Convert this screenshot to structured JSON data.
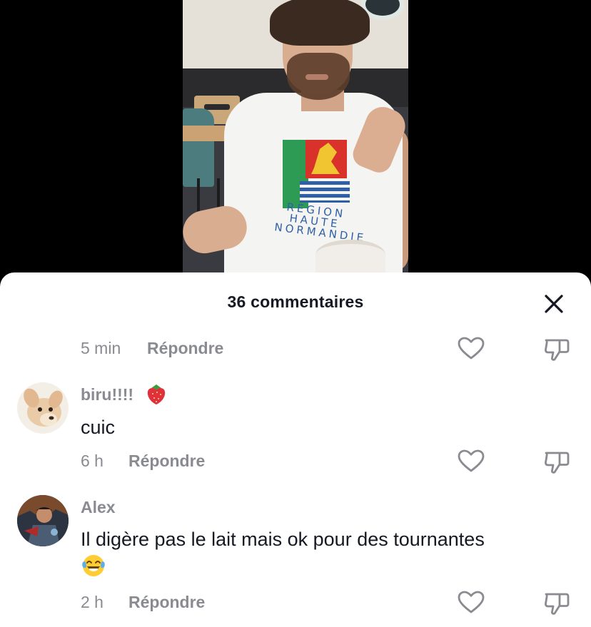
{
  "sheet": {
    "title": "36 commentaires",
    "close_icon": "close-icon"
  },
  "comments": [
    {
      "time": "5 min",
      "reply_label": "Répondre",
      "like_icon": "heart-outline-icon",
      "dislike_icon": "thumbs-down-icon"
    },
    {
      "username": "biru!!!!",
      "username_emoji": "strawberry",
      "avatar": "chihuahua-avatar",
      "text": "cuic",
      "time": "6 h",
      "reply_label": "Répondre",
      "like_icon": "heart-outline-icon",
      "dislike_icon": "thumbs-down-icon"
    },
    {
      "username": "Alex",
      "avatar": "armored-character-avatar",
      "text": "Il digère pas le lait mais ok pour des tournantes",
      "text_emoji": "face-with-tears-of-joy",
      "time": "2 h",
      "reply_label": "Répondre",
      "like_icon": "heart-outline-icon",
      "dislike_icon": "thumbs-down-icon"
    }
  ],
  "colors": {
    "background": "#000000",
    "sheet": "#ffffff",
    "primary_text": "#161823",
    "secondary_text": "#8a8b91"
  }
}
